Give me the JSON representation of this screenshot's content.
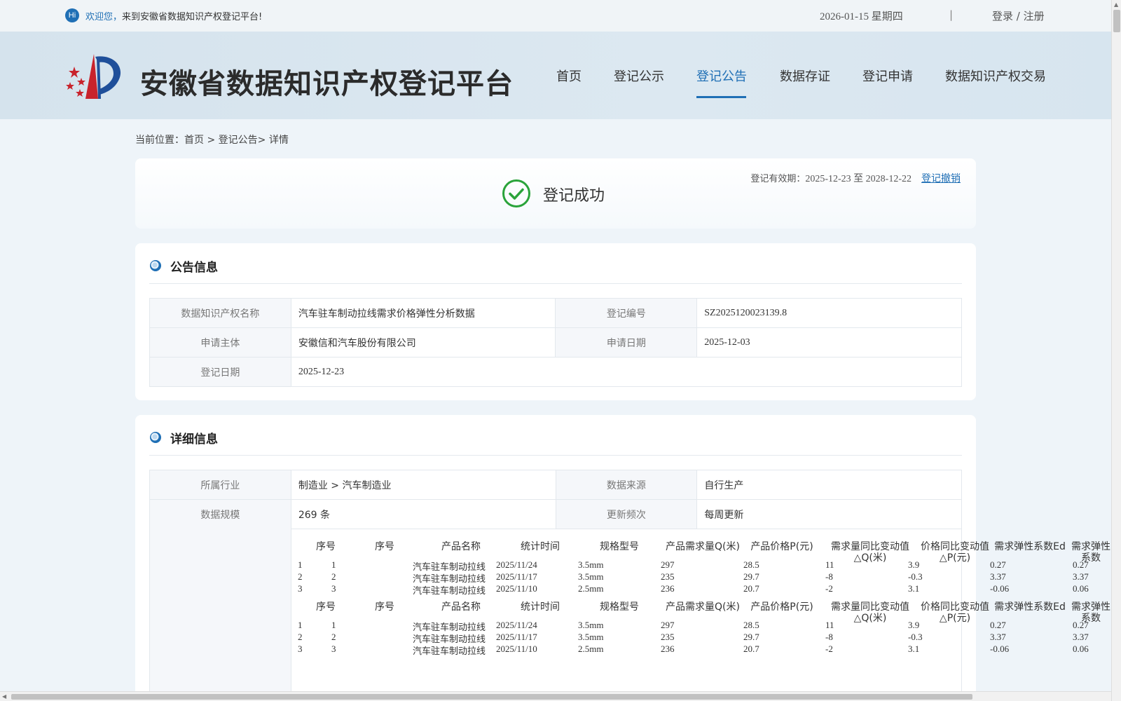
{
  "topbar": {
    "hi": "Hi",
    "welcome_highlight": "欢迎您，",
    "welcome_text": "来到安徽省数据知识产权登记平台!",
    "date": "2026-01-15 星期四",
    "separator": "|",
    "login": "登录",
    "slash": " / ",
    "register": "注册"
  },
  "header": {
    "site_title": "安徽省数据知识产权登记平台",
    "nav": [
      {
        "label": "首页",
        "active": false
      },
      {
        "label": "登记公示",
        "active": false
      },
      {
        "label": "登记公告",
        "active": true
      },
      {
        "label": "数据存证",
        "active": false
      },
      {
        "label": "登记申请",
        "active": false
      },
      {
        "label": "数据知识产权交易",
        "active": false
      }
    ]
  },
  "breadcrumb": {
    "prefix": "当前位置：",
    "home": "首页",
    "sep1": " > ",
    "section": "登记公告",
    "sep2": "> ",
    "current": "详情"
  },
  "status": {
    "validity_label": "登记有效期：",
    "validity_value": "2025-12-23 至 2028-12-22",
    "revoke": "登记撤销",
    "text": "登记成功",
    "color": "#2aa33a"
  },
  "announcement": {
    "title": "公告信息",
    "rows": [
      {
        "k1": "数据知识产权名称",
        "v1": "汽车驻车制动拉线需求价格弹性分析数据",
        "k2": "登记编号",
        "v2": "SZ2025120023139.8"
      },
      {
        "k1": "申请主体",
        "v1": "安徽信和汽车股份有限公司",
        "k2": "申请日期",
        "v2": "2025-12-03"
      },
      {
        "k1": "登记日期",
        "v1": "2025-12-23"
      }
    ]
  },
  "detail": {
    "title": "详细信息",
    "rows": [
      {
        "k1": "所属行业",
        "v1": "制造业 > 汽车制造业",
        "k2": "数据来源",
        "v2": "自行生产"
      },
      {
        "k1": "数据规模",
        "v1": "269 条",
        "k2": "更新频次",
        "v2": "每周更新"
      }
    ],
    "sample_headers": [
      "序号",
      "序号",
      "产品名称",
      "统计时间",
      "规格型号",
      "产品需求量Q(米)",
      "产品价格P(元)",
      "需求量同比变动值△Q(米)",
      "价格同比变动值△P(元)",
      "需求弹性系数Ed",
      "需求弹性系数"
    ],
    "sample_rows": [
      [
        "1",
        "1",
        "汽车驻车制动拉线",
        "2025/11/24",
        "3.5mm",
        "297",
        "28.5",
        "11",
        "3.9",
        "0.27",
        "0.27"
      ],
      [
        "2",
        "2",
        "汽车驻车制动拉线",
        "2025/11/17",
        "3.5mm",
        "235",
        "29.7",
        "-8",
        "-0.3",
        "3.37",
        "3.37"
      ],
      [
        "3",
        "3",
        "汽车驻车制动拉线",
        "2025/11/10",
        "2.5mm",
        "236",
        "20.7",
        "-2",
        "3.1",
        "-0.06",
        "0.06"
      ]
    ]
  },
  "colors": {
    "brand_blue": "#1f6fb5",
    "success_green": "#2aa33a"
  },
  "icons": [
    "hi-icon",
    "emblem-logo",
    "check-circle-icon",
    "section-bullet-icon"
  ]
}
